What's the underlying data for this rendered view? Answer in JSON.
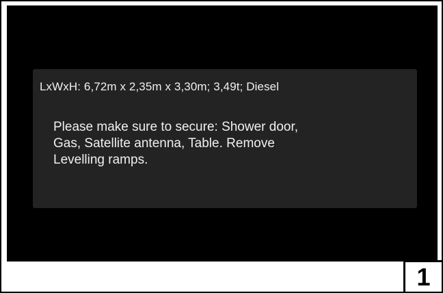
{
  "vehicle_info": {
    "dimensions_text": "LxWxH:  6,72m x  2,35m x  3,30m;  3,49t; Diesel",
    "message_line_1": "Please make sure to secure: Shower door,",
    "message_line_2": "Gas, Satellite antenna, Table. Remove",
    "message_line_3": "Levelling ramps."
  },
  "figure": {
    "step_number": "1"
  },
  "colors": {
    "screen_background": "#000000",
    "panel_background": "#232323",
    "text": "#f0f0f0"
  }
}
